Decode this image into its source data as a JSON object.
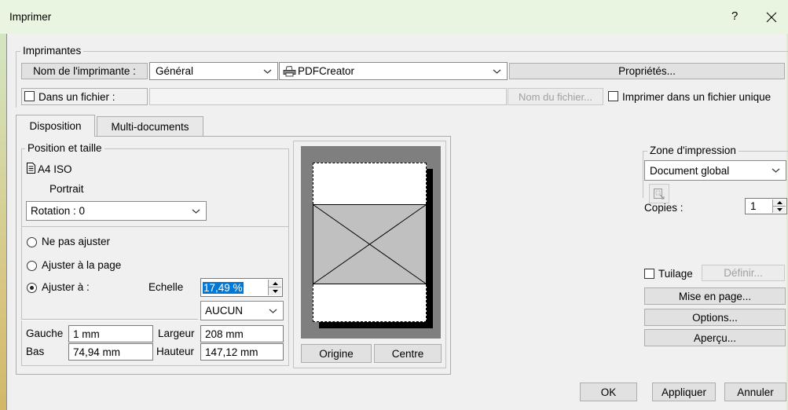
{
  "window": {
    "title": "Imprimer",
    "help_label": "?"
  },
  "printers": {
    "group_label": "Imprimantes",
    "name_button": "Nom de l'imprimante :",
    "category": "Général",
    "printer": "PDFCreator",
    "printer_icon": "printer-icon",
    "properties_button": "Propriétés...",
    "to_file": {
      "label": "Dans un fichier :",
      "checked": false
    },
    "filename": "",
    "filename_button": "Nom du fichier...",
    "single_file": {
      "label": "Imprimer dans un fichier unique",
      "checked": false
    }
  },
  "tabs": [
    {
      "label": "Disposition",
      "selected": true
    },
    {
      "label": "Multi-documents",
      "selected": false
    }
  ],
  "layout": {
    "group_label": "Position et taille",
    "paper": "A4 ISO",
    "paper_icon": "document-icon",
    "orientation": "Portrait",
    "rotation": "Rotation : 0",
    "fit_options": [
      {
        "label": "Ne pas ajuster",
        "selected": false
      },
      {
        "label": "Ajuster à la page",
        "selected": false
      },
      {
        "label": "Ajuster à :",
        "selected": true
      }
    ],
    "scale": {
      "label": "Echelle",
      "value": "17,49 %"
    },
    "fit_mode": "AUCUN",
    "left": {
      "label": "Gauche",
      "value": "1 mm"
    },
    "width": {
      "label": "Largeur",
      "value": "208 mm"
    },
    "bottom": {
      "label": "Bas",
      "value": "74,94 mm"
    },
    "height": {
      "label": "Hauteur",
      "value": "147,12 mm"
    }
  },
  "preview": {
    "origin_button": "Origine",
    "center_button": "Centre"
  },
  "print_area": {
    "group_label": "Zone d'impression",
    "value": "Document global",
    "icon": "selection-icon"
  },
  "copies": {
    "label": "Copies :",
    "value": "1"
  },
  "tiling": {
    "label": "Tuilage",
    "checked": false,
    "define_button": "Définir..."
  },
  "actions": {
    "page_setup": "Mise en page...",
    "options": "Options...",
    "preview": "Aperçu..."
  },
  "footer": {
    "ok": "OK",
    "apply": "Appliquer",
    "cancel": "Annuler"
  },
  "colors": {
    "title_bar": "#e9f5e0",
    "dialog": "#f0f0f0",
    "selection": "#0078d7",
    "preview_background": "#7f7f7f",
    "image_fill": "#c0c0c0"
  }
}
